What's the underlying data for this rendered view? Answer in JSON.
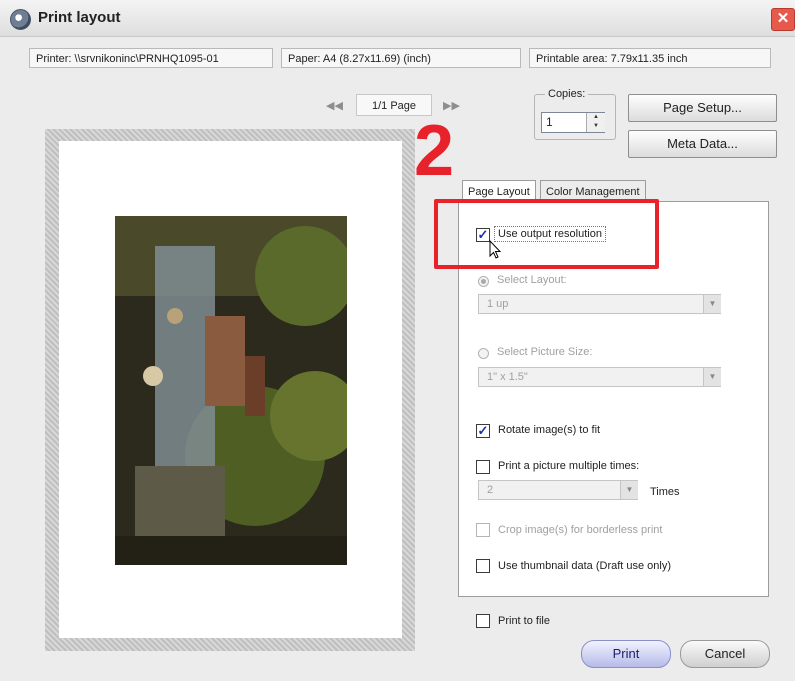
{
  "window": {
    "title": "Print layout",
    "close": "✕"
  },
  "info": {
    "printer": "Printer:  \\\\srvnikoninc\\PRNHQ1095-01",
    "paper": "Paper:  A4 (8.27x11.69) (inch)",
    "printable_area": "Printable area:  7.79x11.35 inch"
  },
  "pager": {
    "prev": "◀◀",
    "page": "1/1 Page",
    "next": "▶▶"
  },
  "copies": {
    "label": "Copies:",
    "value": "1"
  },
  "buttons": {
    "page_setup": "Page Setup...",
    "meta_data": "Meta Data...",
    "print": "Print",
    "cancel": "Cancel"
  },
  "annotation": {
    "number": "2",
    "color": "#e8222b"
  },
  "tabs": [
    {
      "label": "Page Layout",
      "active": true
    },
    {
      "label": "Color Management",
      "active": false
    }
  ],
  "options": {
    "use_output_resolution": {
      "label": "Use output resolution",
      "checked": true
    },
    "select_layout": {
      "label": "Select Layout:",
      "selected": true,
      "value": "1 up"
    },
    "select_picture_size": {
      "label": "Select Picture Size:",
      "selected": false,
      "value": "1\" x 1.5\""
    },
    "rotate": {
      "label": "Rotate image(s) to fit",
      "checked": true
    },
    "print_multiple": {
      "label": "Print a picture multiple times:",
      "checked": false,
      "value": "2",
      "unit": "Times"
    },
    "crop": {
      "label": "Crop image(s) for borderless print",
      "checked": false
    },
    "thumbnail": {
      "label": "Use thumbnail data (Draft use only)",
      "checked": false
    },
    "print_to_file": {
      "label": "Print to file",
      "checked": false
    }
  },
  "icons": [
    "app-icon",
    "close-icon",
    "prev-page-icon",
    "next-page-icon",
    "spin-up-icon",
    "spin-down-icon",
    "dropdown-arrow-icon",
    "mouse-cursor-icon",
    "checkmark-icon"
  ]
}
